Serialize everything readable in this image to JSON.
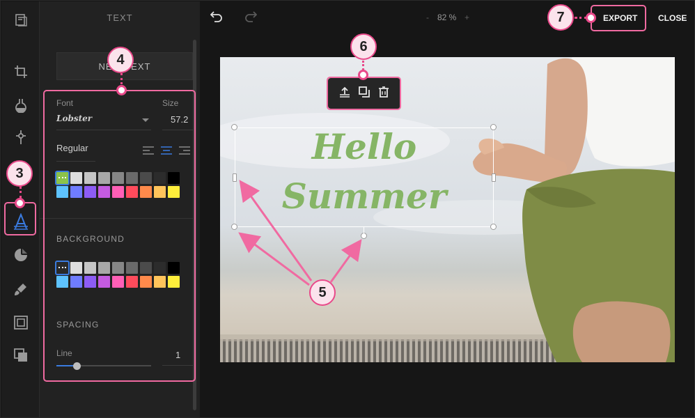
{
  "panel": {
    "title": "TEXT",
    "new_text_button": "NEW TEXT",
    "font_label": "Font",
    "font_value": "Lobster",
    "size_label": "Size",
    "size_value": "57.2",
    "style_value": "Regular",
    "background_label": "BACKGROUND",
    "spacing_label": "SPACING",
    "line_label": "Line",
    "line_value": "1",
    "line_slider_fraction": 0.12
  },
  "colors": {
    "row1": [
      "#8bc34a",
      "#dedede",
      "#c5c5c5",
      "#a8a8a8",
      "#878787",
      "#6a6a6a",
      "#4b4b4b",
      "#2c2c2c",
      "#000000"
    ],
    "row2": [
      "#5ec3ff",
      "#6f7cff",
      "#8d5cf5",
      "#c45be0",
      "#ff5fb6",
      "#ff4b5c",
      "#ff8a4b",
      "#ffc45b",
      "#ffee3b"
    ],
    "bg_row1": [
      "#2a2a2a",
      "#dedede",
      "#c5c5c5",
      "#a8a8a8",
      "#878787",
      "#6a6a6a",
      "#4b4b4b",
      "#2c2c2c",
      "#000000"
    ],
    "accent": "#3a7be0",
    "callout": "#e9498a",
    "text_fill": "#86b566"
  },
  "topbar": {
    "zoom_minus": "-",
    "zoom_value": "82 %",
    "zoom_plus": "+",
    "export_label": "EXPORT",
    "close_label": "CLOSE"
  },
  "canvas": {
    "line1": "Hello",
    "line2": "Summer"
  },
  "callouts": {
    "c3": "3",
    "c4": "4",
    "c5": "5",
    "c6": "6",
    "c7": "7"
  },
  "icons": {
    "rail": [
      "library-icon",
      "crop-icon",
      "filter-icon",
      "adjust-icon",
      "text-icon",
      "sticker-icon",
      "brush-icon",
      "frame-icon",
      "overlay-icon"
    ],
    "toolbar": [
      "bring-front-icon",
      "duplicate-icon",
      "delete-icon"
    ]
  }
}
